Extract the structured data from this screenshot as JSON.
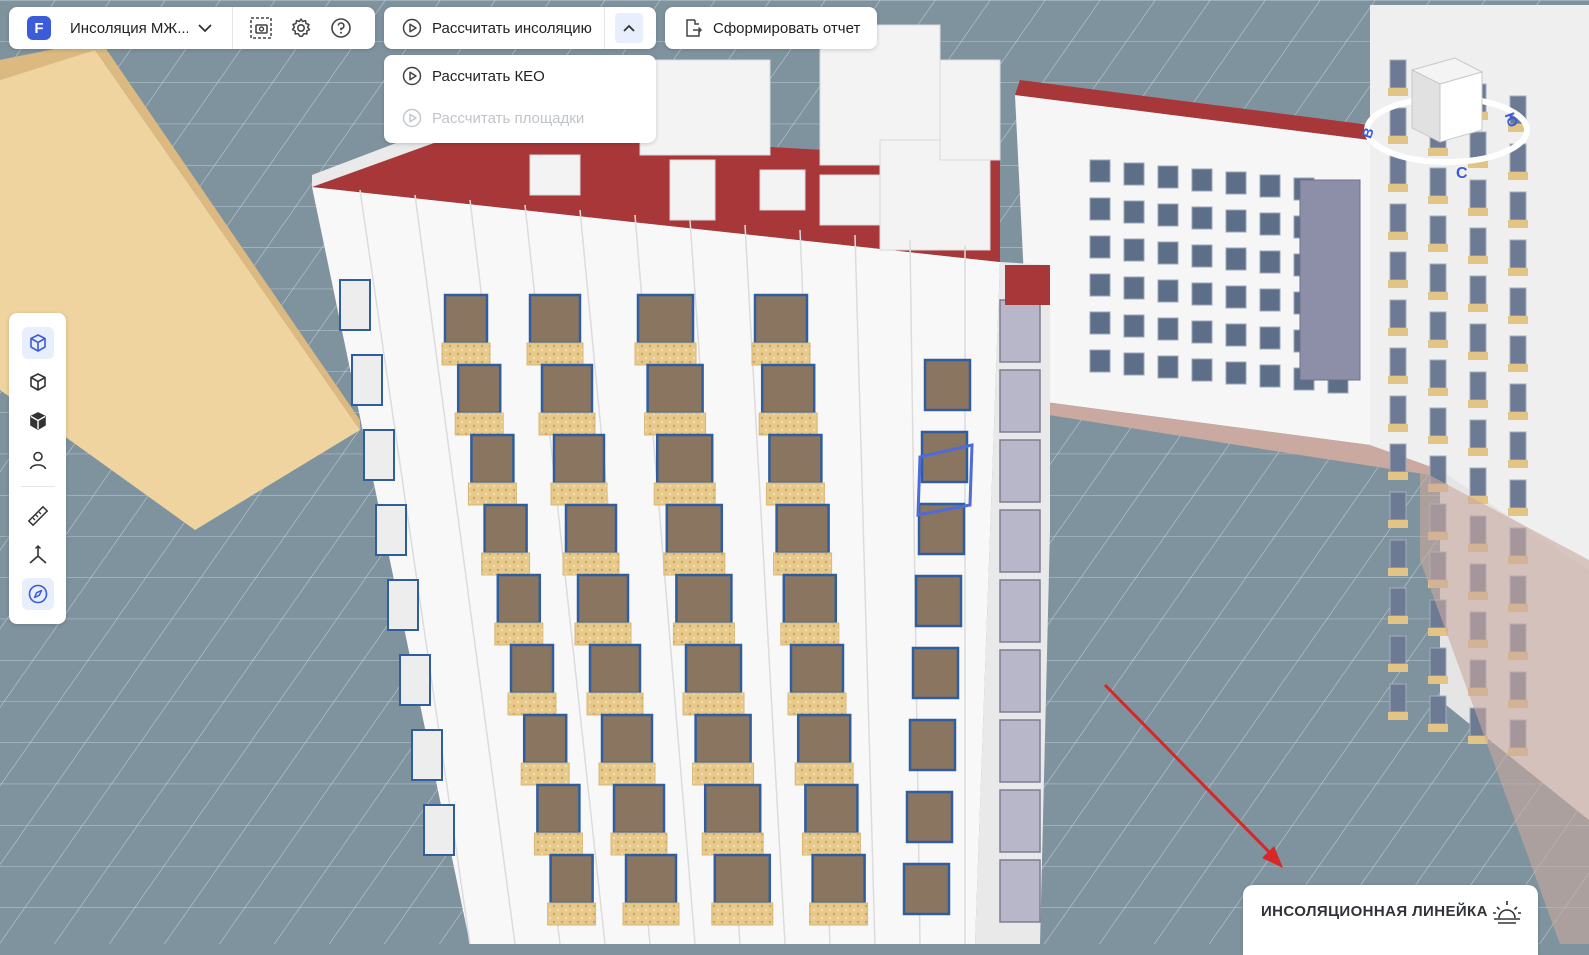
{
  "project": {
    "logo_letter": "F",
    "name": "Инсоляция МЖ..."
  },
  "toolbar": {
    "screenshot_icon": "camera-capture-icon",
    "settings_icon": "gear-icon",
    "help_icon": "help-circle-icon"
  },
  "calc": {
    "main_label": "Рассчитать инсоляцию",
    "dropdown": [
      {
        "label": "Рассчитать КЕО",
        "enabled": true
      },
      {
        "label": "Рассчитать площадки",
        "enabled": false
      }
    ]
  },
  "report": {
    "label": "Сформировать отчет"
  },
  "left_tools": [
    {
      "name": "view-cube-icon",
      "active": true
    },
    {
      "name": "wireframe-cube-icon",
      "active": false
    },
    {
      "name": "solid-cube-icon",
      "active": false
    },
    {
      "name": "person-icon",
      "active": false
    },
    {
      "name": "ruler-icon",
      "active": false
    },
    {
      "name": "axes-icon",
      "active": false
    },
    {
      "name": "compass-icon",
      "active": true
    }
  ],
  "viewcube": {
    "letters": [
      "В",
      "Ю",
      "С"
    ]
  },
  "insolation_ruler": {
    "label": "ИНСОЛЯЦИОННАЯ ЛИНЕЙКА",
    "icon": "sunrise-icon"
  },
  "colors": {
    "accent": "#3b5bdb",
    "roof": "#a8373a",
    "ground": "#7f939f",
    "arrow": "#d62828"
  }
}
